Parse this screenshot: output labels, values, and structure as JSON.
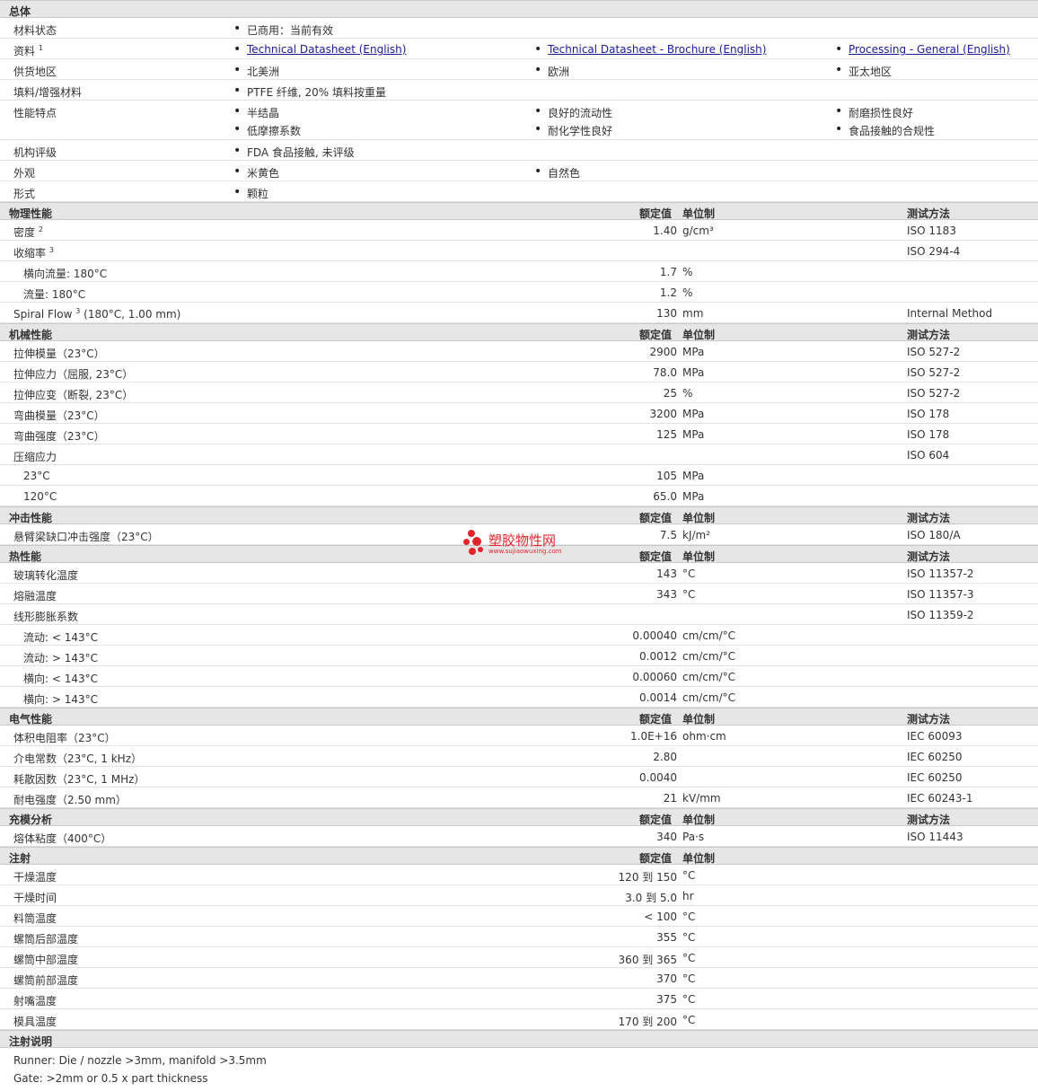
{
  "general": {
    "heading": "总体",
    "rows": [
      {
        "label": "材料状态",
        "items": [
          "已商用：当前有效"
        ]
      },
      {
        "label": "资料",
        "sup": "1",
        "links": [
          "Technical Datasheet (English)",
          "Technical Datasheet - Brochure (English)",
          "Processing - General (English)"
        ]
      },
      {
        "label": "供货地区",
        "items": [
          "北美洲",
          "欧洲",
          "亚太地区"
        ]
      },
      {
        "label": "填料/增强材料",
        "items": [
          "PTFE 纤维, 20% 填料按重量"
        ]
      },
      {
        "label": "性能特点",
        "items": [
          "半结晶",
          "良好的流动性",
          "耐磨损性良好",
          "低摩擦系数",
          "耐化学性良好",
          "食品接触的合规性"
        ]
      },
      {
        "label": "机构评级",
        "items": [
          "FDA 食品接触, 未评级"
        ]
      },
      {
        "label": "外观",
        "items": [
          "米黄色",
          "自然色"
        ]
      },
      {
        "label": "形式",
        "items": [
          "颗粒"
        ]
      }
    ]
  },
  "headers": {
    "value": "额定值",
    "unit": "单位制",
    "method": "测试方法"
  },
  "sections": [
    {
      "title": "物理性能",
      "has_method": true,
      "rows": [
        {
          "label": "密度",
          "sup": "2",
          "value": "1.40",
          "unit": "g/cm³",
          "method": "ISO 1183"
        },
        {
          "label": "收缩率",
          "sup": "3",
          "value": "",
          "unit": "",
          "method": "ISO 294-4"
        },
        {
          "label": "横向流量: 180°C",
          "sub": true,
          "value": "1.7",
          "unit": "%",
          "method": ""
        },
        {
          "label": "流量: 180°C",
          "sub": true,
          "value": "1.2",
          "unit": "%",
          "method": ""
        },
        {
          "label": "Spiral Flow",
          "sup": "3",
          "suffix": " (180°C, 1.00 mm)",
          "value": "130",
          "unit": "mm",
          "method": "Internal Method"
        }
      ]
    },
    {
      "title": "机械性能",
      "has_method": true,
      "rows": [
        {
          "label": "拉伸模量（23°C）",
          "value": "2900",
          "unit": "MPa",
          "method": "ISO 527-2"
        },
        {
          "label": "拉伸应力（屈服, 23°C）",
          "value": "78.0",
          "unit": "MPa",
          "method": "ISO 527-2"
        },
        {
          "label": "拉伸应变（断裂, 23°C）",
          "value": "25",
          "unit": "%",
          "method": "ISO 527-2"
        },
        {
          "label": "弯曲模量（23°C）",
          "value": "3200",
          "unit": "MPa",
          "method": "ISO 178"
        },
        {
          "label": "弯曲强度（23°C）",
          "value": "125",
          "unit": "MPa",
          "method": "ISO 178"
        },
        {
          "label": "压缩应力",
          "value": "",
          "unit": "",
          "method": "ISO 604"
        },
        {
          "label": "23°C",
          "sub": true,
          "value": "105",
          "unit": "MPa",
          "method": ""
        },
        {
          "label": "120°C",
          "sub": true,
          "value": "65.0",
          "unit": "MPa",
          "method": ""
        }
      ]
    },
    {
      "title": "冲击性能",
      "has_method": true,
      "rows": [
        {
          "label": "悬臂梁缺口冲击强度（23°C）",
          "value": "7.5",
          "unit": "kJ/m²",
          "method": "ISO 180/A"
        }
      ]
    },
    {
      "title": "热性能",
      "has_method": true,
      "rows": [
        {
          "label": "玻璃转化温度",
          "value": "143",
          "unit": "°C",
          "method": "ISO 11357-2"
        },
        {
          "label": "熔融温度",
          "value": "343",
          "unit": "°C",
          "method": "ISO 11357-3"
        },
        {
          "label": "线形膨胀系数",
          "value": "",
          "unit": "",
          "method": "ISO 11359-2"
        },
        {
          "label": "流动: < 143°C",
          "sub": true,
          "value": "0.00040",
          "unit": "cm/cm/°C",
          "method": ""
        },
        {
          "label": "流动: > 143°C",
          "sub": true,
          "value": "0.0012",
          "unit": "cm/cm/°C",
          "method": ""
        },
        {
          "label": "横向: < 143°C",
          "sub": true,
          "value": "0.00060",
          "unit": "cm/cm/°C",
          "method": ""
        },
        {
          "label": "横向: > 143°C",
          "sub": true,
          "value": "0.0014",
          "unit": "cm/cm/°C",
          "method": ""
        }
      ]
    },
    {
      "title": "电气性能",
      "has_method": true,
      "rows": [
        {
          "label": "体积电阻率（23°C）",
          "value": "1.0E+16",
          "unit": "ohm·cm",
          "method": "IEC 60093"
        },
        {
          "label": "介电常数（23°C, 1 kHz）",
          "value": "2.80",
          "unit": "",
          "method": "IEC 60250"
        },
        {
          "label": "耗散因数（23°C, 1 MHz）",
          "value": "0.0040",
          "unit": "",
          "method": "IEC 60250"
        },
        {
          "label": "耐电强度（2.50 mm）",
          "value": "21",
          "unit": "kV/mm",
          "method": "IEC 60243-1"
        }
      ]
    },
    {
      "title": "充模分析",
      "has_method": true,
      "rows": [
        {
          "label": "熔体粘度（400°C）",
          "value": "340",
          "unit": "Pa·s",
          "method": "ISO 11443"
        }
      ]
    },
    {
      "title": "注射",
      "has_method": false,
      "rows": [
        {
          "label": "干燥温度",
          "value": "120 到  150",
          "unit": "°C",
          "method": ""
        },
        {
          "label": "干燥时间",
          "value": "3.0 到  5.0",
          "unit": "hr",
          "method": ""
        },
        {
          "label": "料筒温度",
          "value": "< 100",
          "unit": "°C",
          "method": ""
        },
        {
          "label": "螺筒后部温度",
          "value": "355",
          "unit": "°C",
          "method": ""
        },
        {
          "label": "螺筒中部温度",
          "value": "360 到  365",
          "unit": "°C",
          "method": ""
        },
        {
          "label": "螺筒前部温度",
          "value": "370",
          "unit": "°C",
          "method": ""
        },
        {
          "label": "射嘴温度",
          "value": "375",
          "unit": "°C",
          "method": ""
        },
        {
          "label": "模具温度",
          "value": "170 到  200",
          "unit": "°C",
          "method": ""
        }
      ]
    }
  ],
  "notes": {
    "title": "注射说明",
    "lines": [
      "Runner: Die / nozzle >3mm, manifold >3.5mm",
      "Gate: >2mm or 0.5 x part thickness"
    ]
  },
  "watermark": {
    "name": "塑胶物性网",
    "url": "www.sujiaowuxing.com"
  }
}
